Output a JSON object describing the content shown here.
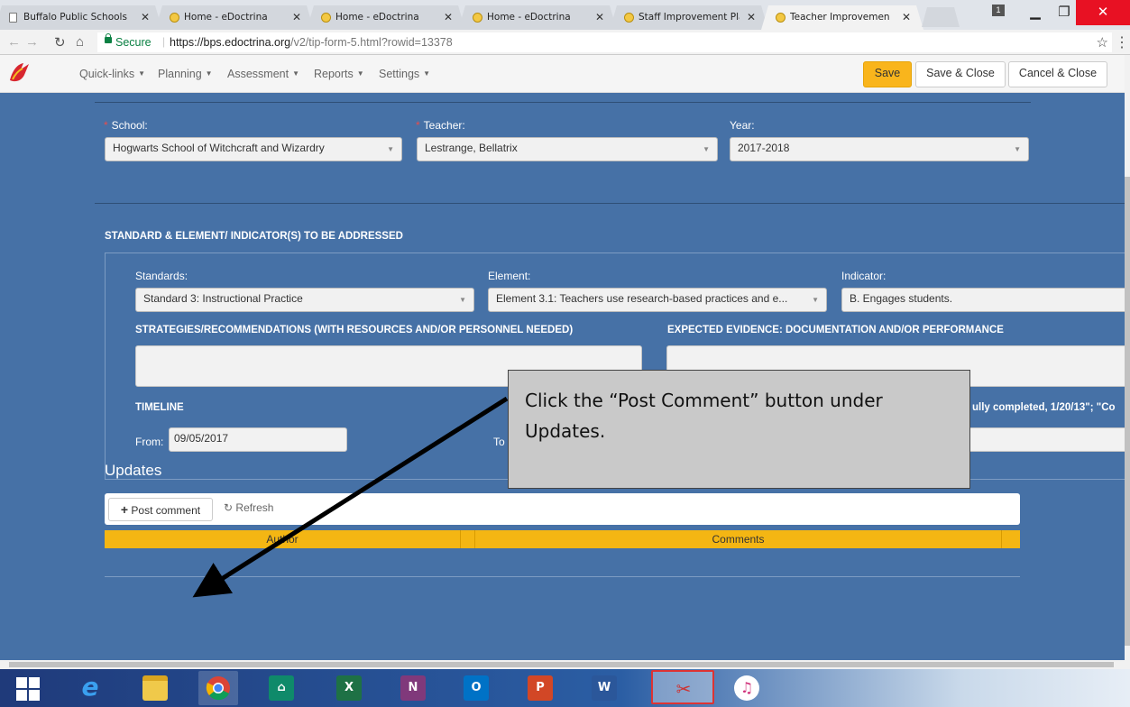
{
  "browser": {
    "tabs": [
      {
        "title": "Buffalo Public Schools"
      },
      {
        "title": "Home - eDoctrina"
      },
      {
        "title": "Home - eDoctrina"
      },
      {
        "title": "Home - eDoctrina"
      },
      {
        "title": "Staff Improvement Plans"
      },
      {
        "title": "Teacher Improvement Pl"
      }
    ],
    "secure_label": "Secure",
    "url_host": "https://bps.edoctrina.org",
    "url_path": "/v2/tip-form-5.html?rowid=13378"
  },
  "navbar": {
    "items": [
      "Quick-links",
      "Planning",
      "Assessment",
      "Reports",
      "Settings"
    ],
    "save": "Save",
    "save_close": "Save & Close",
    "cancel_close": "Cancel & Close"
  },
  "form": {
    "school_label": "School:",
    "school_value": "Hogwarts School of Witchcraft and Wizardry",
    "teacher_label": "Teacher:",
    "teacher_value": "Lestrange, Bellatrix",
    "year_label": "Year:",
    "year_value": "2017-2018",
    "section_heading": "STANDARD & ELEMENT/ INDICATOR(S) TO BE ADDRESSED",
    "standards_label": "Standards:",
    "standards_value": "Standard 3: Instructional Practice",
    "element_label": "Element:",
    "element_value": "Element 3.1: Teachers use research-based practices and e...",
    "indicator_label": "Indicator:",
    "indicator_value": "B. Engages students.",
    "strategies_heading": "STRATEGIES/RECOMMENDATIONS (WITH RESOURCES AND/OR PERSONNEL NEEDED)",
    "evidence_heading": "EXPECTED EVIDENCE: DOCUMENTATION AND/OR PERFORMANCE",
    "timeline_heading": "TIMELINE",
    "from_label": "From:",
    "from_value": "09/05/2017",
    "to_label": "To",
    "hint_fragment": "ully completed, 1/20/13\"; \"Co"
  },
  "updates": {
    "title": "Updates",
    "post_comment": "Post comment",
    "refresh": "Refresh",
    "col_author": "Author",
    "col_comments": "Comments"
  },
  "callout": {
    "text": "Click the “Post Comment” button under Updates."
  },
  "taskbar": {
    "apps": [
      "start",
      "internet-explorer",
      "file-explorer",
      "chrome",
      "store",
      "excel",
      "onenote",
      "outlook",
      "powerpoint",
      "word",
      "snipping-tool",
      "itunes"
    ]
  }
}
